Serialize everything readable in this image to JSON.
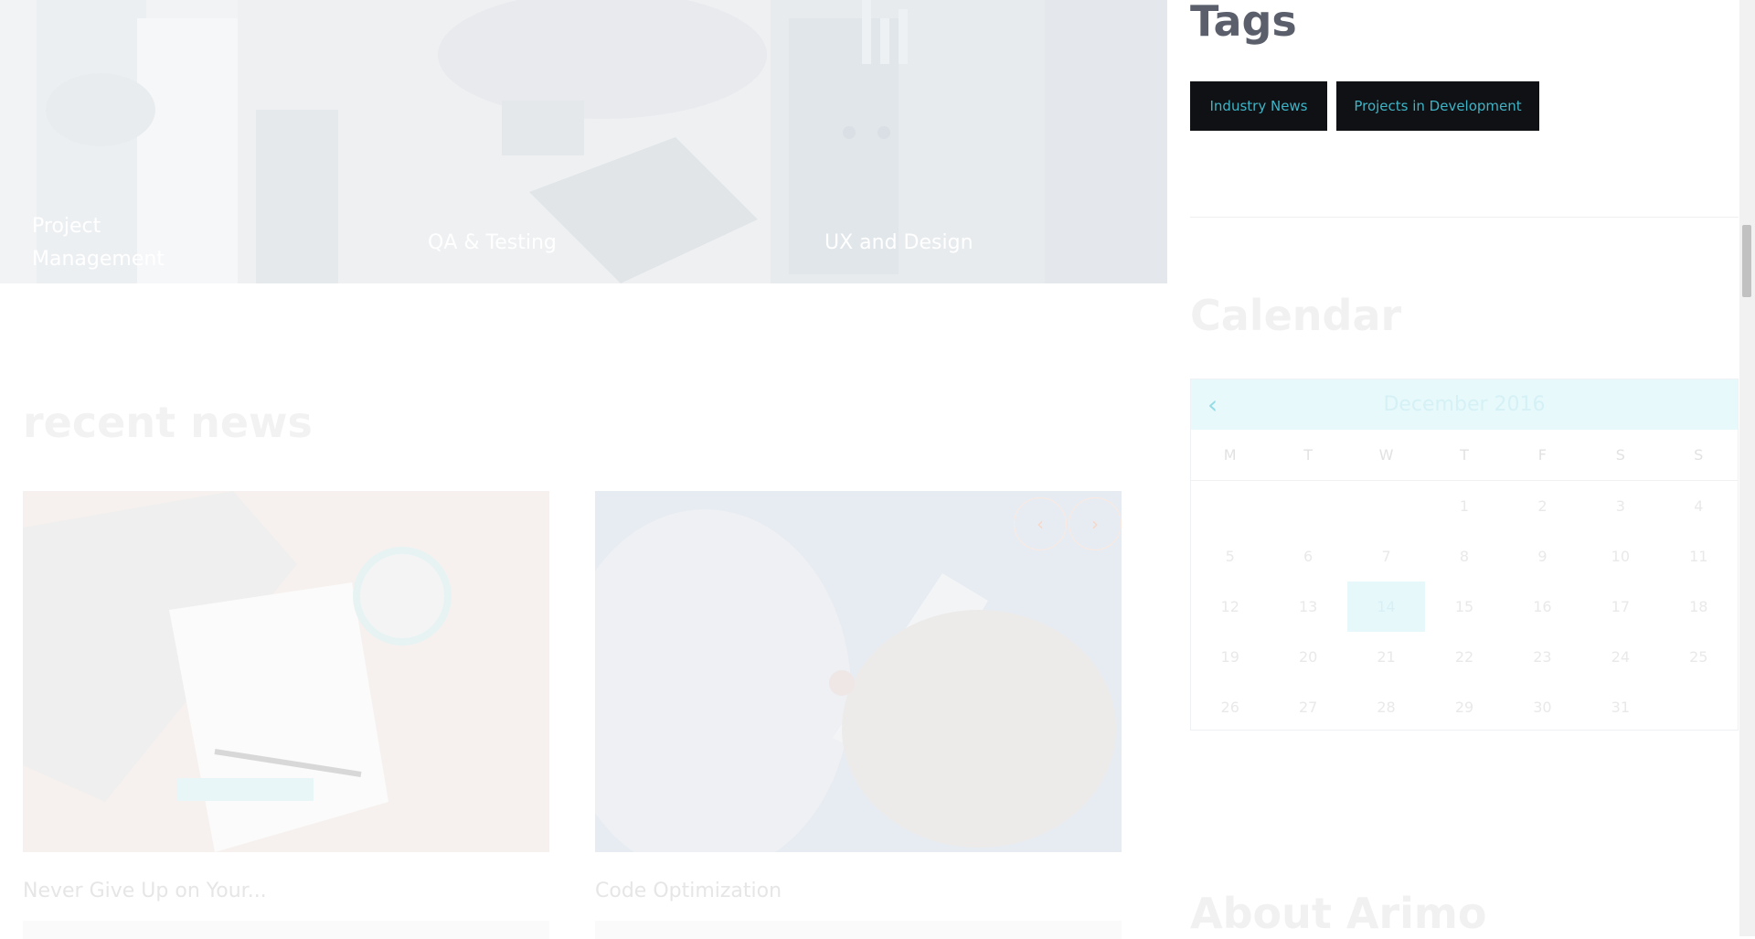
{
  "services": [
    {
      "title": "Project Management"
    },
    {
      "title": "QA & Testing"
    },
    {
      "title": "UX and Design"
    }
  ],
  "recent_news": {
    "heading": "recent news",
    "articles": [
      {
        "title": "Never Give Up on Your..."
      },
      {
        "title": "Code Optimization"
      }
    ],
    "nav": {
      "prev_icon": "chevron-left-icon",
      "next_icon": "chevron-right-icon",
      "prev_glyph": "‹",
      "next_glyph": "›"
    }
  },
  "sidebar": {
    "tags": {
      "heading": "Tags",
      "items": [
        "Industry News",
        "Projects in Development"
      ]
    },
    "calendar": {
      "heading": "Calendar",
      "month_label": "December 2016",
      "prev_glyph": "‹",
      "weekdays": [
        "M",
        "T",
        "W",
        "T",
        "F",
        "S",
        "S"
      ],
      "weeks": [
        [
          "",
          "",
          "",
          "1",
          "2",
          "3",
          "4"
        ],
        [
          "5",
          "6",
          "7",
          "8",
          "9",
          "10",
          "11"
        ],
        [
          "12",
          "13",
          "14",
          "15",
          "16",
          "17",
          "18"
        ],
        [
          "19",
          "20",
          "21",
          "22",
          "23",
          "24",
          "25"
        ],
        [
          "26",
          "27",
          "28",
          "29",
          "30",
          "31",
          ""
        ]
      ],
      "today": "14"
    },
    "about": {
      "heading": "About Arimo"
    }
  },
  "colors": {
    "tag_bg": "#0f1114",
    "tag_text": "#3fb4c7",
    "calendar_highlight": "#e7f8fa"
  }
}
